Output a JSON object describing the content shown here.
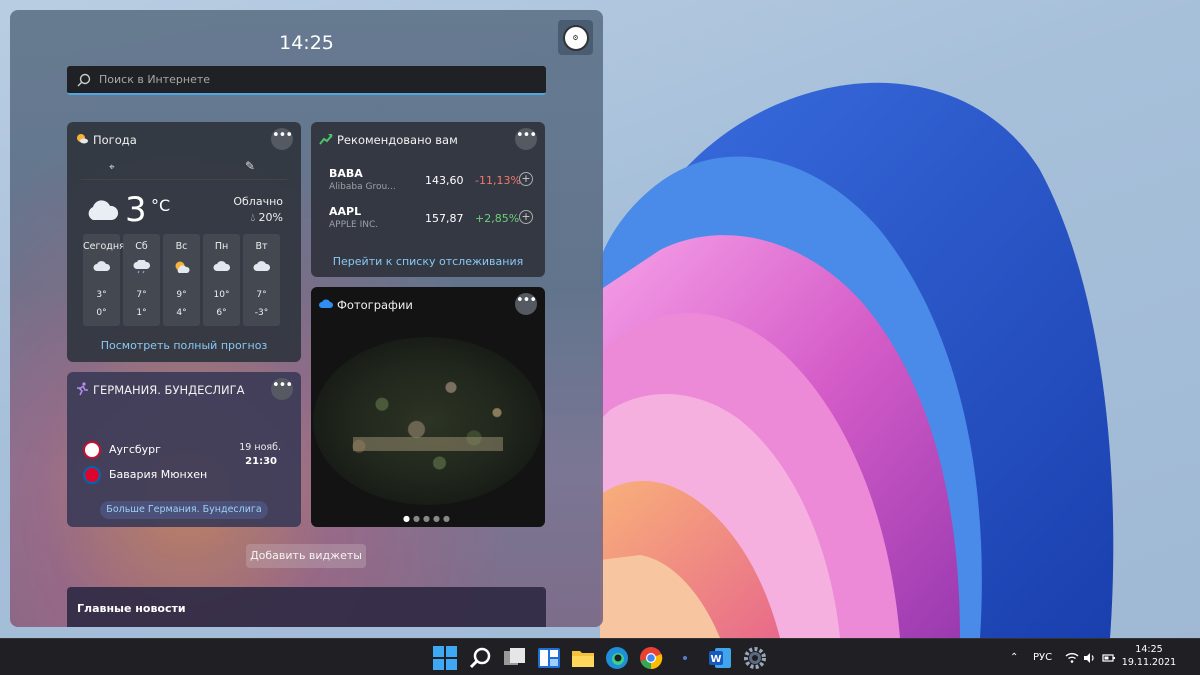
{
  "widgets": {
    "time": "14:25",
    "search_placeholder": "Поиск в Интернете",
    "weather": {
      "title": "Погода",
      "temp": "3",
      "unit": "°C",
      "condition": "Облачно",
      "humidity": "20%",
      "days": [
        {
          "name": "Сегодня",
          "high": "3°",
          "low": "0°",
          "icon": "cloud-icon"
        },
        {
          "name": "Сб",
          "high": "7°",
          "low": "1°",
          "icon": "cloud-rain-icon"
        },
        {
          "name": "Вс",
          "high": "9°",
          "low": "4°",
          "icon": "partly-sunny-icon"
        },
        {
          "name": "Пн",
          "high": "10°",
          "low": "6°",
          "icon": "cloud-icon"
        },
        {
          "name": "Вт",
          "high": "7°",
          "low": "-3°",
          "icon": "cloud-icon"
        }
      ],
      "link": "Посмотреть полный прогноз"
    },
    "stocks": {
      "title": "Рекомендовано вам",
      "items": [
        {
          "symbol": "BABA",
          "name": "Alibaba Grou...",
          "price": "143,60",
          "change": "-11,13%",
          "color": "#f0796c"
        },
        {
          "symbol": "AAPL",
          "name": "APPLE INC.",
          "price": "157,87",
          "change": "+2,85%",
          "color": "#6cd07a"
        }
      ],
      "link": "Перейти к списку отслеживания"
    },
    "photos": {
      "title": "Фотографии"
    },
    "sport": {
      "title": "ГЕРМАНИЯ. БУНДЕСЛИГА",
      "team1": "Аугсбург",
      "team2": "Бавария Мюнхен",
      "date": "19 нояб.",
      "time": "21:30",
      "link": "Больше Германия. Бундеслига"
    },
    "more": "•••",
    "add_widgets": "Добавить виджеты",
    "news_title": "Главные новости"
  },
  "taskbar": {
    "lang": "РУС",
    "time": "14:25",
    "date": "19.11.2021",
    "apps": [
      "start-icon",
      "search-icon",
      "task-view-icon",
      "widgets-icon",
      "file-explorer-icon",
      "edge-icon",
      "chrome-icon",
      "app-icon",
      "word-icon",
      "settings-icon"
    ]
  }
}
